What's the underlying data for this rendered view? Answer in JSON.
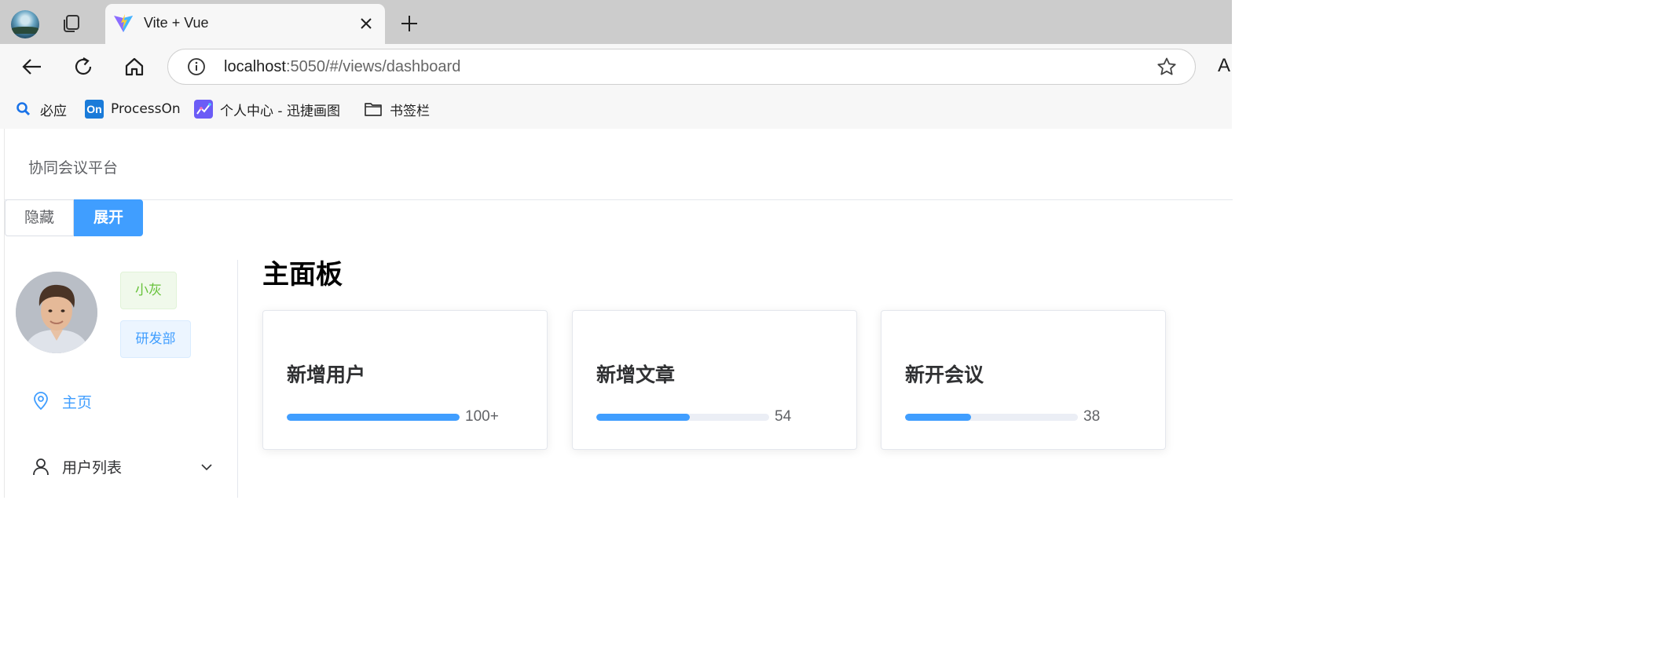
{
  "browser": {
    "tab_title": "Vite + Vue",
    "url_host": "localhost",
    "url_rest": ":5050/#/views/dashboard",
    "edge_letter": "A",
    "bookmarks": [
      {
        "label": "必应",
        "icon": "search-icon"
      },
      {
        "label": "ProcessOn",
        "icon": "processon-icon",
        "icon_text": "On"
      },
      {
        "label": "个人中心 - 迅捷画图",
        "icon": "chart-app-icon"
      },
      {
        "label": "书签栏",
        "icon": "folder-icon"
      }
    ]
  },
  "app": {
    "brand": "协同会议平台",
    "toggle": {
      "hide_label": "隐藏",
      "expand_label": "展开"
    },
    "user": {
      "name": "小灰",
      "department": "研发部"
    },
    "menu": [
      {
        "label": "主页",
        "icon": "location-pin-icon",
        "active": true
      },
      {
        "label": "用户列表",
        "icon": "user-icon",
        "active": false
      }
    ],
    "main_title": "主面板",
    "cards": [
      {
        "title": "新增用户",
        "progress": 100,
        "text": "100+"
      },
      {
        "title": "新增文章",
        "progress": 54,
        "text": "54"
      },
      {
        "title": "新开会议",
        "progress": 38,
        "text": "38"
      }
    ]
  },
  "colors": {
    "primary": "#409eff",
    "success": "#67c23a",
    "text": "#303133"
  }
}
